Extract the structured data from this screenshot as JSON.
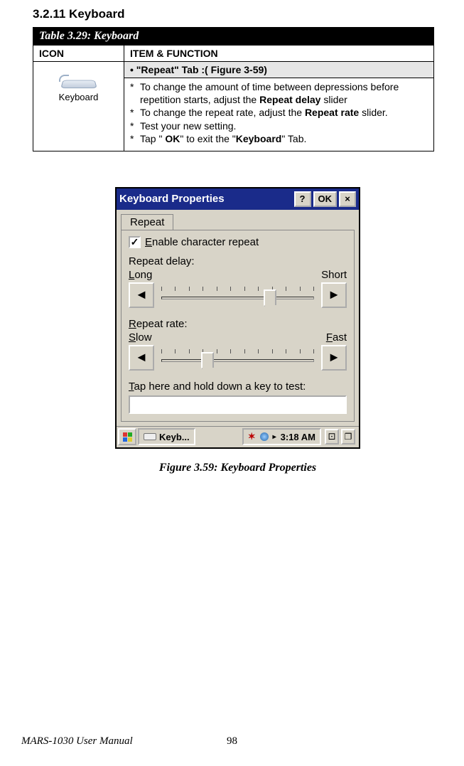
{
  "heading": "3.2.11   Keyboard",
  "table": {
    "title": "Table 3.29: Keyboard",
    "col_icon": "ICON",
    "col_item": "ITEM & FUNCTION",
    "icon_label": "Keyboard",
    "subheader": "•  \"Repeat\" Tab :( Figure 3-59)",
    "li1_a": "To change the amount of time between depressions before repetition starts, adjust the ",
    "li1_b": "Repeat delay",
    "li1_c": " slider",
    "li2_a": "To change the repeat rate, adjust the ",
    "li2_b": "Repeat rate",
    "li2_c": " slider.",
    "li3": "Test your new setting.",
    "li4_a": "Tap \" ",
    "li4_b": "OK",
    "li4_c": "\" to exit the \"",
    "li4_d": "Keyboard",
    "li4_e": "\" Tab."
  },
  "kp": {
    "title": "Keyboard Properties",
    "help": "?",
    "ok": "OK",
    "close": "×",
    "tab": "Repeat",
    "check_mark": "✓",
    "enable_pre": "E",
    "enable_rest": "nable character repeat",
    "delay_label": "Repeat delay:",
    "long_pre": "L",
    "long_rest": "ong",
    "short": "Short",
    "rate_pre": "R",
    "rate_rest": "epeat rate:",
    "slow_pre": "S",
    "slow_rest": "low",
    "fast_pre": "F",
    "fast_rest": "ast",
    "test_pre": "T",
    "test_rest": "ap here and hold down a key to test:",
    "left": "◄",
    "right": "►",
    "task_label": "Keyb...",
    "tray_x": "✶",
    "tray_time": "3:18 AM",
    "tray_arrow": "▸",
    "tray_ic1": "⚀",
    "tray_ic2": "❐"
  },
  "figure_caption": "Figure 3.59: Keyboard Properties",
  "footer_left": "MARS-1030 User Manual",
  "footer_page": "98"
}
